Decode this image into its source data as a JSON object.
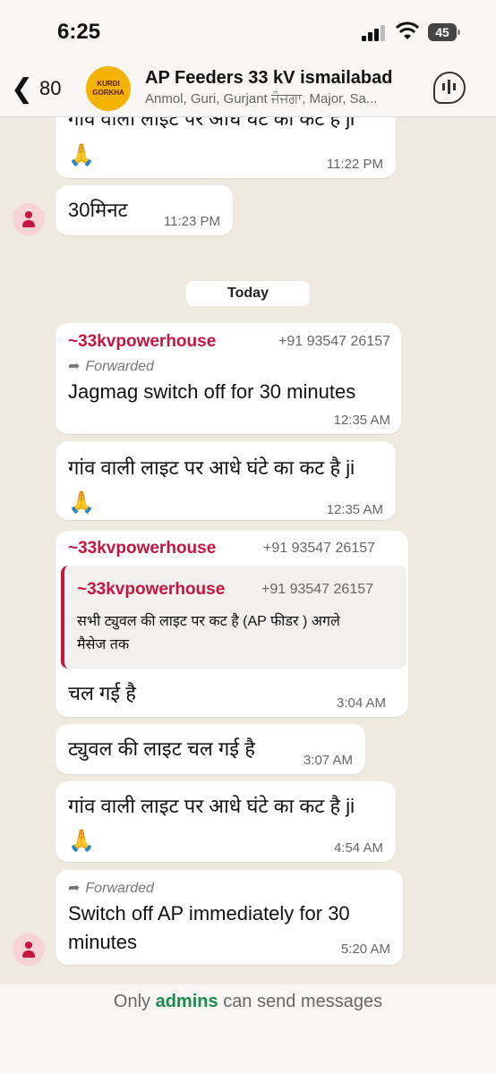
{
  "status": {
    "time": "6:25",
    "battery": "45"
  },
  "header": {
    "back_count": "80",
    "avatar_lines": [
      "KURDI",
      "GORKHA"
    ],
    "title": "AP Feeders 33 kV ismailabad",
    "members": "Anmol, Guri, Gurjant ਜੰਜਗਾ, Major, Sa..."
  },
  "messages": [
    {
      "text": "गांव वाली लाइट पर आधे घंटे का कट है ji",
      "emoji": "🙏",
      "time": "11:22 PM"
    },
    {
      "text": "30मिनट",
      "time": "11:23 PM"
    },
    {
      "date": "Today"
    },
    {
      "sender": "~33kvpowerhouse",
      "phone": "+91 93547 26157",
      "forwarded": "Forwarded",
      "text": "Jagmag switch off for 30 minutes",
      "time": "12:35 AM"
    },
    {
      "text": "गांव वाली लाइट पर आधे घंटे का कट है ji",
      "emoji": "🙏",
      "time": "12:35 AM"
    },
    {
      "sender": "~33kvpowerhouse",
      "phone": "+91 93547 26157",
      "quote": {
        "sender": "~33kvpowerhouse",
        "phone": "+91 93547 26157",
        "line1": "सभी ट्युवल की लाइट पर कट है (AP फीडर ) अगले",
        "line2": "मैसेज तक"
      },
      "text": "चल गई है",
      "time": "3:04 AM"
    },
    {
      "text": "ट्युवल की लाइट चल गई है",
      "time": "3:07 AM"
    },
    {
      "text": "गांव वाली लाइट पर आधे घंटे का कट है ji",
      "emoji": "🙏",
      "time": "4:54 AM"
    },
    {
      "forwarded": "Forwarded",
      "line1": "Switch off AP immediately for 30",
      "line2": "minutes",
      "time": "5:20 AM"
    }
  ],
  "footer": {
    "prefix": "Only",
    "link": "admins",
    "suffix": "can send messages"
  }
}
